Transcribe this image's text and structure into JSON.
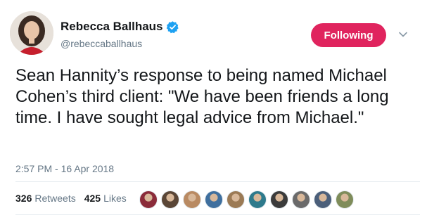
{
  "author": {
    "display_name": "Rebecca Ballhaus",
    "handle": "@rebeccaballhaus",
    "verified": true
  },
  "follow_button": {
    "label": "Following",
    "color": "#e0245e"
  },
  "tweet": {
    "text": "Sean Hannity’s response to being named Michael Cohen’s third client: \"We have been friends a long time. I have sought legal advice from Michael.\"",
    "timestamp": "2:57 PM - 16 Apr 2018"
  },
  "stats": {
    "retweets_count": "326",
    "retweets_label": "Retweets",
    "likes_count": "425",
    "likes_label": "Likes"
  },
  "liker_avatars": [
    "#8b2c3a",
    "#5a4636",
    "#b98a62",
    "#3f6f9e",
    "#9b7a55",
    "#2e7a8c",
    "#3b3b3b",
    "#6a6a6a",
    "#4b5f7a",
    "#7f8c5a"
  ],
  "colors": {
    "accent": "#e0245e",
    "verified_blue": "#1da1f2",
    "secondary_text": "#657786"
  },
  "icons": {
    "verified": "verified-badge-icon",
    "caret": "chevron-down-icon"
  }
}
